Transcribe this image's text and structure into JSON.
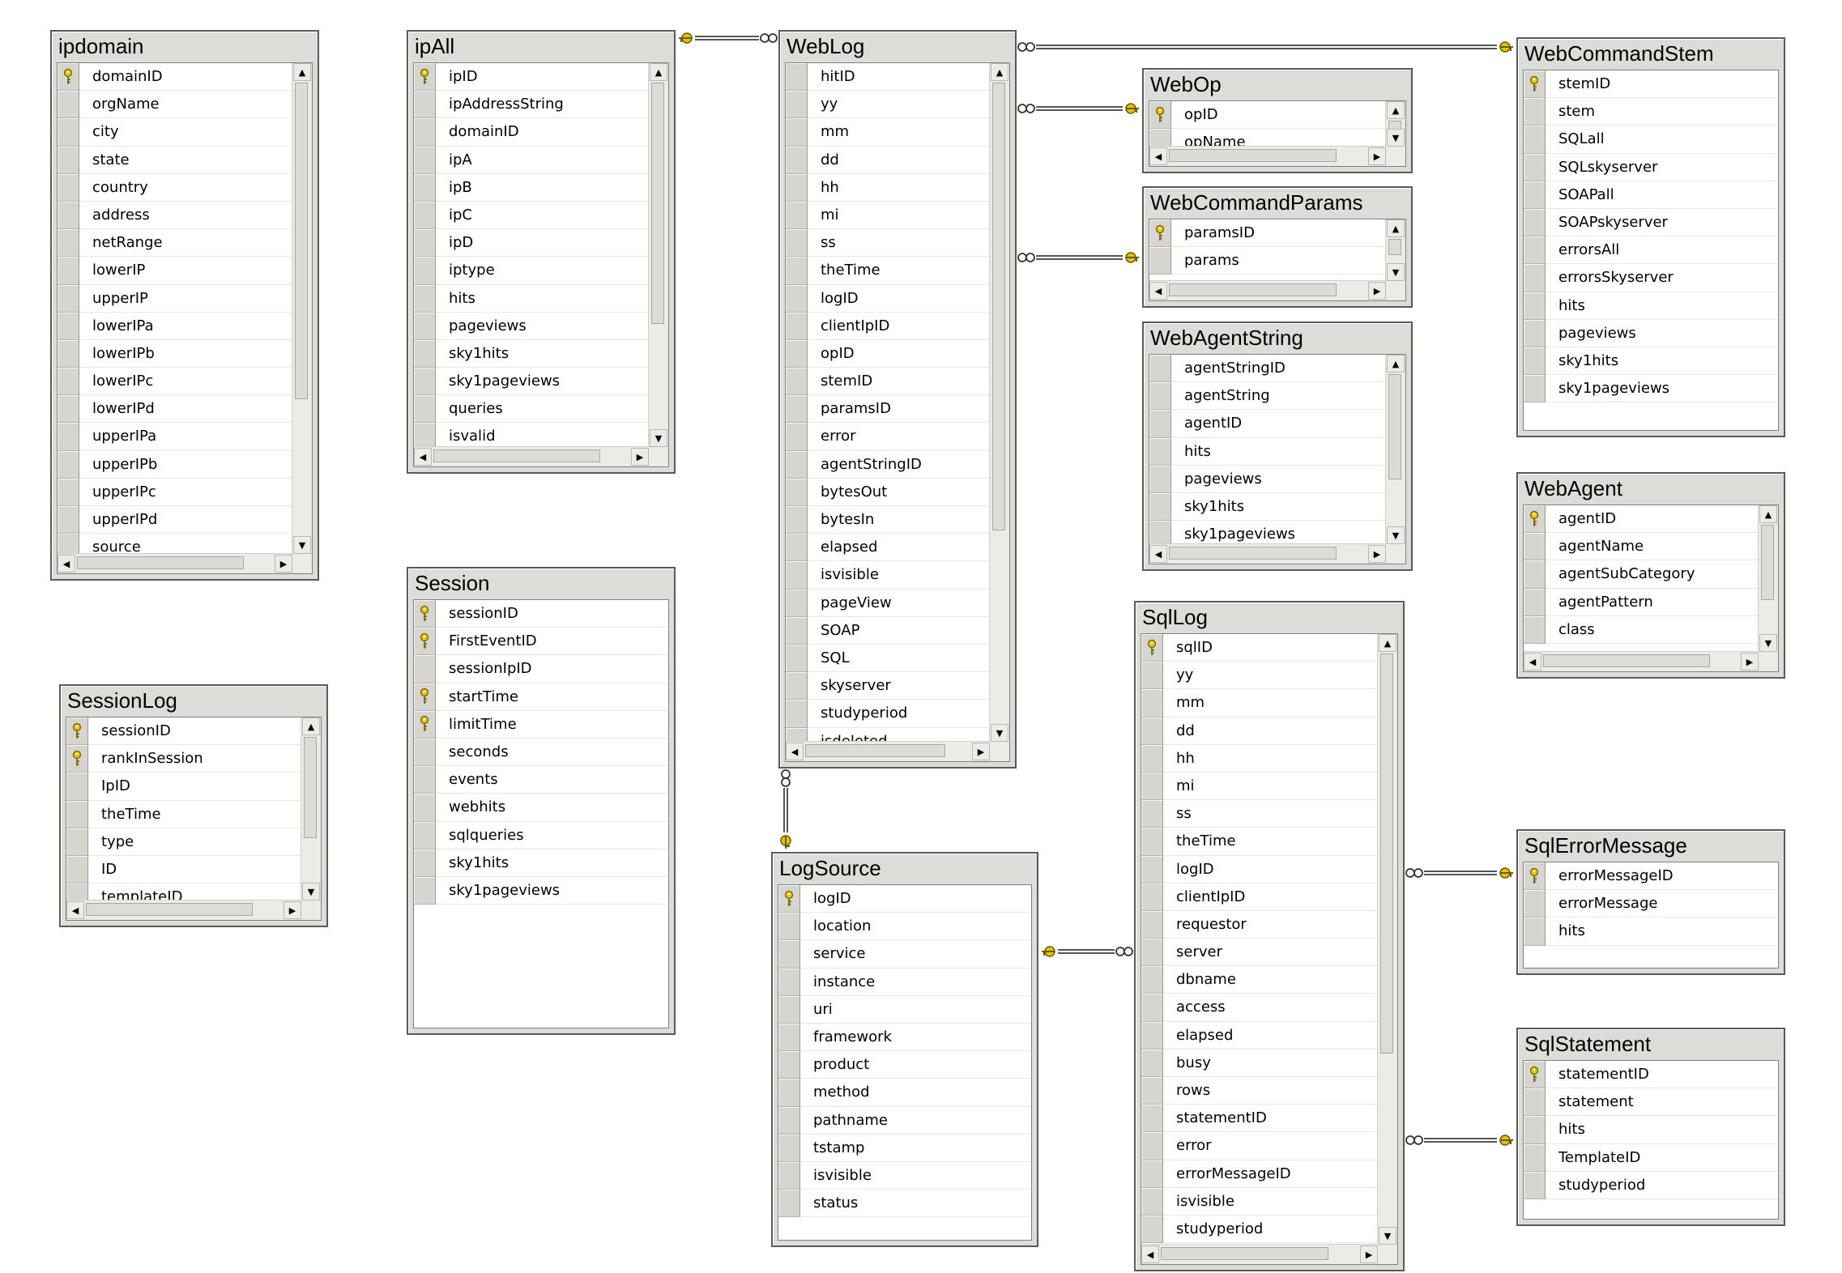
{
  "tables": [
    {
      "id": "ipdomain",
      "title": "ipdomain",
      "vscroll": true,
      "hscroll": true,
      "columns": [
        {
          "name": "domainID",
          "key": true
        },
        {
          "name": "orgName"
        },
        {
          "name": "city"
        },
        {
          "name": "state"
        },
        {
          "name": "country"
        },
        {
          "name": "address"
        },
        {
          "name": "netRange"
        },
        {
          "name": "lowerIP"
        },
        {
          "name": "upperIP"
        },
        {
          "name": "lowerIPa"
        },
        {
          "name": "lowerIPb"
        },
        {
          "name": "lowerIPc"
        },
        {
          "name": "lowerIPd"
        },
        {
          "name": "upperIPa"
        },
        {
          "name": "upperIPb"
        },
        {
          "name": "upperIPc"
        },
        {
          "name": "upperIPd"
        },
        {
          "name": "source"
        }
      ]
    },
    {
      "id": "ipAll",
      "title": "ipAll",
      "vscroll": true,
      "hscroll": true,
      "columns": [
        {
          "name": "ipID",
          "key": true
        },
        {
          "name": "ipAddressString"
        },
        {
          "name": "domainID"
        },
        {
          "name": "ipA"
        },
        {
          "name": "ipB"
        },
        {
          "name": "ipC"
        },
        {
          "name": "ipD"
        },
        {
          "name": "iptype"
        },
        {
          "name": "hits"
        },
        {
          "name": "pageviews"
        },
        {
          "name": "sky1hits"
        },
        {
          "name": "sky1pageviews"
        },
        {
          "name": "queries"
        },
        {
          "name": "isvalid"
        }
      ]
    },
    {
      "id": "WebLog",
      "title": "WebLog",
      "vscroll": true,
      "hscroll": true,
      "columns": [
        {
          "name": "hitID"
        },
        {
          "name": "yy"
        },
        {
          "name": "mm"
        },
        {
          "name": "dd"
        },
        {
          "name": "hh"
        },
        {
          "name": "mi"
        },
        {
          "name": "ss"
        },
        {
          "name": "theTime"
        },
        {
          "name": "logID"
        },
        {
          "name": "clientIpID"
        },
        {
          "name": "opID"
        },
        {
          "name": "stemID"
        },
        {
          "name": "paramsID"
        },
        {
          "name": "error"
        },
        {
          "name": "agentStringID"
        },
        {
          "name": "bytesOut"
        },
        {
          "name": "bytesIn"
        },
        {
          "name": "elapsed"
        },
        {
          "name": "isvisible"
        },
        {
          "name": "pageView"
        },
        {
          "name": "SOAP"
        },
        {
          "name": "SQL"
        },
        {
          "name": "skyserver"
        },
        {
          "name": "studyperiod"
        },
        {
          "name": "isdeleted"
        }
      ]
    },
    {
      "id": "WebOp",
      "title": "WebOp",
      "vscroll": true,
      "hscroll": true,
      "columns": [
        {
          "name": "opID",
          "key": true
        },
        {
          "name": "opName"
        }
      ]
    },
    {
      "id": "WebCommandParams",
      "title": "WebCommandParams",
      "vscroll": true,
      "hscroll": true,
      "columns": [
        {
          "name": "paramsID",
          "key": true
        },
        {
          "name": "params"
        }
      ]
    },
    {
      "id": "WebAgentString",
      "title": "WebAgentString",
      "vscroll": true,
      "hscroll": true,
      "columns": [
        {
          "name": "agentStringID"
        },
        {
          "name": "agentString"
        },
        {
          "name": "agentID"
        },
        {
          "name": "hits"
        },
        {
          "name": "pageviews"
        },
        {
          "name": "sky1hits"
        },
        {
          "name": "sky1pageviews"
        }
      ]
    },
    {
      "id": "WebCommandStem",
      "title": "WebCommandStem",
      "vscroll": false,
      "hscroll": false,
      "columns": [
        {
          "name": "stemID",
          "key": true
        },
        {
          "name": "stem"
        },
        {
          "name": "SQLall"
        },
        {
          "name": "SQLskyserver"
        },
        {
          "name": "SOAPall"
        },
        {
          "name": "SOAPskyserver"
        },
        {
          "name": "errorsAll"
        },
        {
          "name": "errorsSkyserver"
        },
        {
          "name": "hits"
        },
        {
          "name": "pageviews"
        },
        {
          "name": "sky1hits"
        },
        {
          "name": "sky1pageviews"
        }
      ]
    },
    {
      "id": "WebAgent",
      "title": "WebAgent",
      "vscroll": true,
      "hscroll": true,
      "columns": [
        {
          "name": "agentID",
          "key": true
        },
        {
          "name": "agentName"
        },
        {
          "name": "agentSubCategory"
        },
        {
          "name": "agentPattern"
        },
        {
          "name": "class"
        }
      ]
    },
    {
      "id": "SessionLog",
      "title": "SessionLog",
      "vscroll": true,
      "hscroll": true,
      "columns": [
        {
          "name": "sessionID",
          "key": true
        },
        {
          "name": "rankInSession",
          "key": true
        },
        {
          "name": "IpID"
        },
        {
          "name": "theTime"
        },
        {
          "name": "type"
        },
        {
          "name": "ID"
        },
        {
          "name": "templateID"
        }
      ]
    },
    {
      "id": "Session",
      "title": "Session",
      "vscroll": false,
      "hscroll": false,
      "columns": [
        {
          "name": "sessionID",
          "key": true
        },
        {
          "name": "FirstEventID",
          "key": true
        },
        {
          "name": "sessionIpID"
        },
        {
          "name": "startTime",
          "key": true
        },
        {
          "name": "limitTime",
          "key": true
        },
        {
          "name": "seconds"
        },
        {
          "name": "events"
        },
        {
          "name": "webhits"
        },
        {
          "name": "sqlqueries"
        },
        {
          "name": "sky1hits"
        },
        {
          "name": "sky1pageviews"
        }
      ]
    },
    {
      "id": "LogSource",
      "title": "LogSource",
      "vscroll": false,
      "hscroll": false,
      "columns": [
        {
          "name": "logID",
          "key": true
        },
        {
          "name": "location"
        },
        {
          "name": "service"
        },
        {
          "name": "instance"
        },
        {
          "name": "uri"
        },
        {
          "name": "framework"
        },
        {
          "name": "product"
        },
        {
          "name": "method"
        },
        {
          "name": "pathname"
        },
        {
          "name": "tstamp"
        },
        {
          "name": "isvisible"
        },
        {
          "name": "status"
        }
      ]
    },
    {
      "id": "SqlLog",
      "title": "SqlLog",
      "vscroll": true,
      "hscroll": true,
      "columns": [
        {
          "name": "sqlID",
          "key": true
        },
        {
          "name": "yy"
        },
        {
          "name": "mm"
        },
        {
          "name": "dd"
        },
        {
          "name": "hh"
        },
        {
          "name": "mi"
        },
        {
          "name": "ss"
        },
        {
          "name": "theTime"
        },
        {
          "name": "logID"
        },
        {
          "name": "clientIpID"
        },
        {
          "name": "requestor"
        },
        {
          "name": "server"
        },
        {
          "name": "dbname"
        },
        {
          "name": "access"
        },
        {
          "name": "elapsed"
        },
        {
          "name": "busy"
        },
        {
          "name": "rows"
        },
        {
          "name": "statementID"
        },
        {
          "name": "error"
        },
        {
          "name": "errorMessageID"
        },
        {
          "name": "isvisible"
        },
        {
          "name": "studyperiod"
        }
      ]
    },
    {
      "id": "SqlErrorMessage",
      "title": "SqlErrorMessage",
      "vscroll": false,
      "hscroll": false,
      "columns": [
        {
          "name": "errorMessageID",
          "key": true
        },
        {
          "name": "errorMessage"
        },
        {
          "name": "hits"
        }
      ]
    },
    {
      "id": "SqlStatement",
      "title": "SqlStatement",
      "vscroll": false,
      "hscroll": false,
      "columns": [
        {
          "name": "statementID",
          "key": true
        },
        {
          "name": "statement"
        },
        {
          "name": "hits"
        },
        {
          "name": "TemplateID"
        },
        {
          "name": "studyperiod"
        }
      ]
    }
  ],
  "relationships": [
    {
      "from": "ipAll",
      "to": "WebLog"
    },
    {
      "from": "WebLog",
      "to": "WebCommandStem"
    },
    {
      "from": "WebLog",
      "to": "WebOp"
    },
    {
      "from": "WebLog",
      "to": "WebCommandParams"
    },
    {
      "from": "WebLog",
      "to": "LogSource"
    },
    {
      "from": "LogSource",
      "to": "SqlLog"
    },
    {
      "from": "SqlLog",
      "to": "SqlErrorMessage"
    },
    {
      "from": "SqlLog",
      "to": "SqlStatement"
    }
  ],
  "colors": {
    "key_icon": "#e6c200",
    "connector": "#555555",
    "table_frame": "#dcdcd8"
  },
  "icons": {
    "primary_key": "key-icon"
  }
}
